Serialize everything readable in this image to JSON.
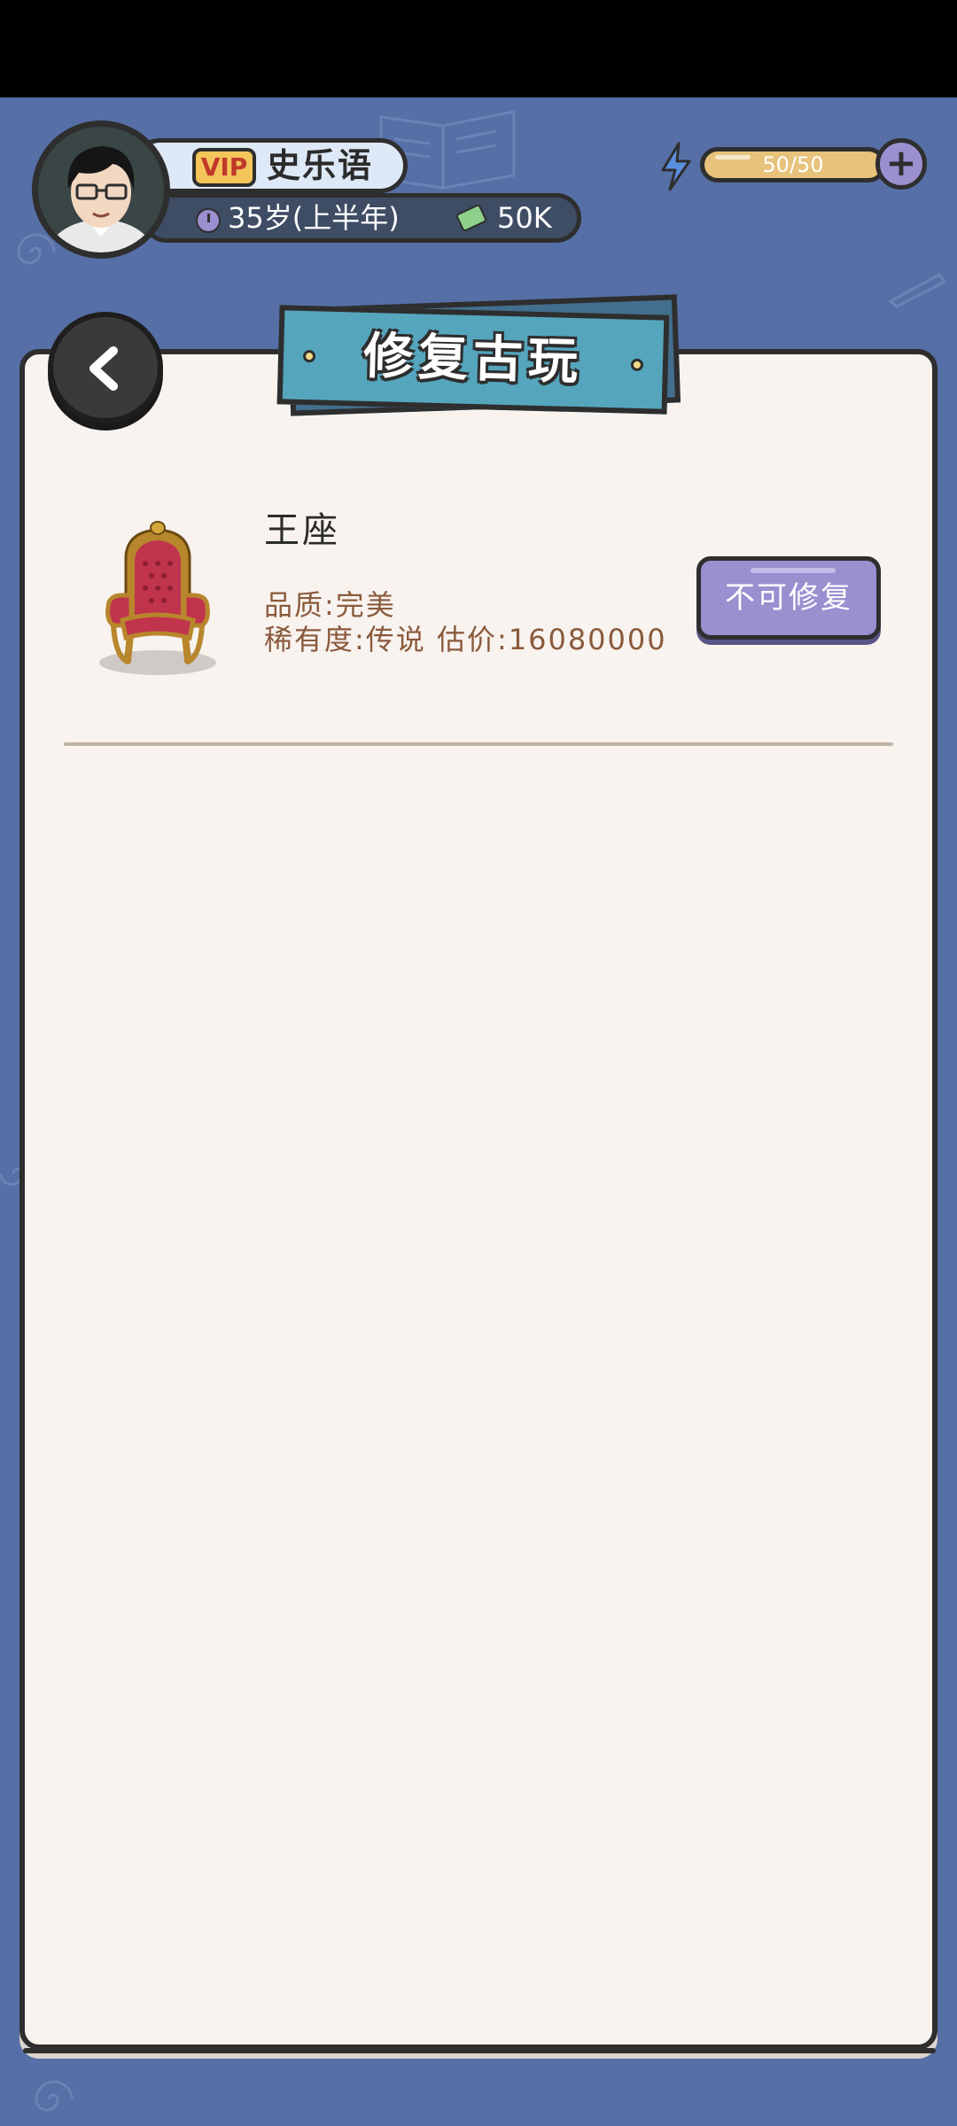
{
  "player": {
    "vip_label": "VIP",
    "name": "史乐语",
    "age": "35岁(上半年)",
    "money": "50K",
    "energy": "50/50",
    "energy_level": 1.0,
    "avatar_icon": "player-avatar-icon"
  },
  "header": {
    "back_icon": "chevron-left-icon",
    "title": "修复古玩"
  },
  "items": [
    {
      "name": "王座",
      "quality": "品质:完美",
      "rarity_price": "稀有度:传说 估价:16080000",
      "button_label": "不可修复",
      "icon": "throne-icon"
    }
  ],
  "colors": {
    "background": "#566fa6",
    "panel": "#f8f3ef",
    "title_tag": "#55a5bd",
    "button": "#9b8fd0",
    "text_brown": "#8a5a3c"
  }
}
